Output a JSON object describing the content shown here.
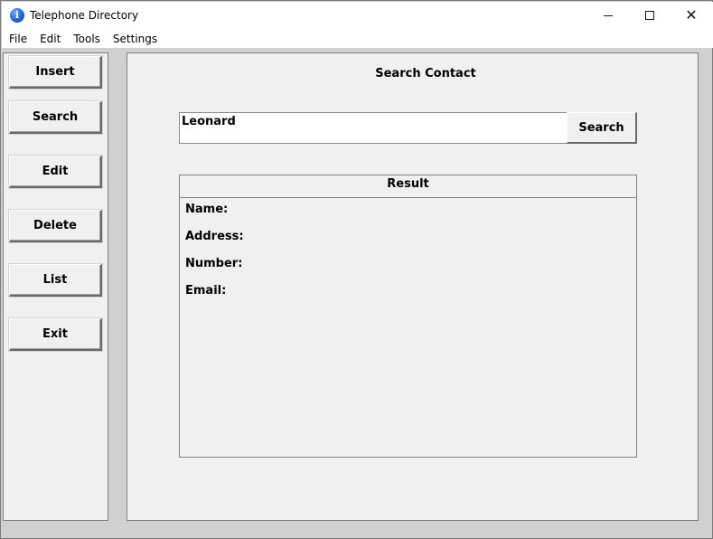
{
  "window": {
    "title": "Telephone Directory",
    "icon": "info-icon"
  },
  "menu": [
    "File",
    "Edit",
    "Tools",
    "Settings"
  ],
  "sidebar": {
    "buttons": [
      "Insert",
      "Search",
      "Edit",
      "Delete",
      "List",
      "Exit"
    ]
  },
  "main": {
    "title": "Search Contact",
    "search_value": "Leonard",
    "search_button": "Search",
    "result": {
      "header": "Result",
      "fields": [
        "Name:",
        "Address:",
        "Number:",
        "Email:"
      ]
    }
  },
  "colors": {
    "panel_bg": "#f0f0f0",
    "window_bg": "#d0d0d0",
    "titlebar_bg": "#ffffff"
  }
}
